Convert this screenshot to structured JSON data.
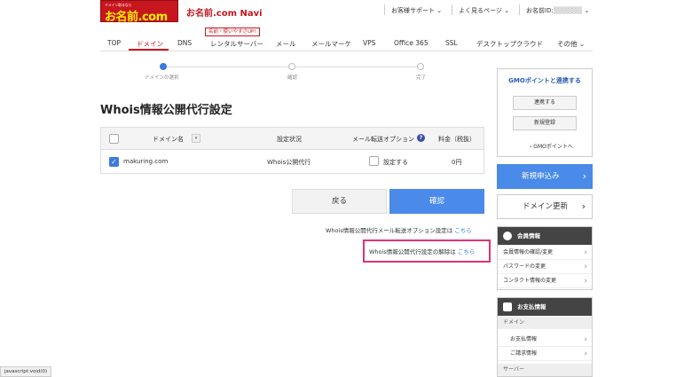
{
  "header": {
    "logo_small": "ドメイン取るなら",
    "logo_main": "お名前.com",
    "title": "お名前.com Navi",
    "support": "お客様サポート",
    "faq": "よく見るページ",
    "user_id_label": "お名前ID:"
  },
  "nav": {
    "badge": "名前・使いやすさUP!",
    "items": [
      "TOP",
      "ドメイン",
      "DNS",
      "レンタルサーバー",
      "メール",
      "メールマーケ",
      "VPS",
      "Office 365",
      "SSL",
      "デスクトップクラウド",
      "その他"
    ]
  },
  "steps": [
    "ドメインの選択",
    "確認",
    "完了"
  ],
  "page_title": "Whois情報公開代行設定",
  "table": {
    "headers": [
      "ドメイン名",
      "設定状況",
      "メール転送オプション",
      "料金（税抜）"
    ],
    "row": {
      "domain": "makuring.com",
      "status": "Whois公開代行",
      "option_label": "設定する",
      "price": "0円"
    }
  },
  "buttons": {
    "back": "戻る",
    "confirm": "確認"
  },
  "notes": {
    "mail_option": "Whois情報公開代行メール転送オプション設定は",
    "release": "Whois情報公開代行設定の解除は",
    "here": "こちら"
  },
  "sidebar": {
    "gmo_title": "GMOポイントと連携する",
    "gmo_link_btn": "連携する",
    "gmo_register_btn": "新規登録",
    "gmo_points_link": "› GMOポイントへ",
    "new_apply": "新規申込み",
    "domain_renew": "ドメイン更新",
    "member_head": "会員情報",
    "member_items": [
      "会員情報の確認/変更",
      "パスワードの変更",
      "コンタクト情報の変更"
    ],
    "payment_head": "お支払情報",
    "payment_sub_domain": "ドメイン",
    "payment_items": [
      "お支払情報",
      "ご請求情報"
    ],
    "payment_sub_server": "サーバー"
  },
  "statusbar": "javascript:void(0)",
  "colors": {
    "brand_red": "#c8161e",
    "accent_blue": "#4a8ae8",
    "highlight_pink": "#e0327a"
  }
}
